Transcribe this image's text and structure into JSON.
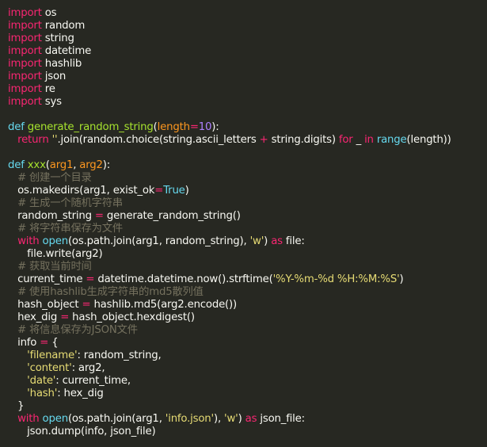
{
  "colors": {
    "background": "#272822",
    "plain": "#f8f8f2",
    "keyword": "#f92672",
    "def": "#66d9ef",
    "func": "#a6e22e",
    "number": "#ae81ff",
    "string": "#e6db74",
    "comment": "#75715e",
    "operator": "#f92672",
    "param": "#fd971f",
    "builtin": "#66d9ef"
  },
  "code": {
    "lines": [
      [
        [
          "keyword",
          "import"
        ],
        [
          "plain",
          " os"
        ]
      ],
      [
        [
          "keyword",
          "import"
        ],
        [
          "plain",
          " random"
        ]
      ],
      [
        [
          "keyword",
          "import"
        ],
        [
          "plain",
          " string"
        ]
      ],
      [
        [
          "keyword",
          "import"
        ],
        [
          "plain",
          " datetime"
        ]
      ],
      [
        [
          "keyword",
          "import"
        ],
        [
          "plain",
          " hashlib"
        ]
      ],
      [
        [
          "keyword",
          "import"
        ],
        [
          "plain",
          " json"
        ]
      ],
      [
        [
          "keyword",
          "import"
        ],
        [
          "plain",
          " re"
        ]
      ],
      [
        [
          "keyword",
          "import"
        ],
        [
          "plain",
          " sys"
        ]
      ],
      [],
      [
        [
          "def",
          "def"
        ],
        [
          "plain",
          " "
        ],
        [
          "func",
          "generate_random_string"
        ],
        [
          "plain",
          "("
        ],
        [
          "param",
          "length"
        ],
        [
          "operator",
          "="
        ],
        [
          "number",
          "10"
        ],
        [
          "plain",
          "):"
        ]
      ],
      [
        [
          "plain",
          "   "
        ],
        [
          "keyword",
          "return"
        ],
        [
          "plain",
          " "
        ],
        [
          "string",
          "''"
        ],
        [
          "plain",
          ".join(random.choice(string.ascii_letters "
        ],
        [
          "operator",
          "+"
        ],
        [
          "plain",
          " string.digits) "
        ],
        [
          "keyword",
          "for"
        ],
        [
          "plain",
          " _ "
        ],
        [
          "keyword",
          "in"
        ],
        [
          "plain",
          " "
        ],
        [
          "builtin",
          "range"
        ],
        [
          "plain",
          "(length))"
        ]
      ],
      [],
      [
        [
          "def",
          "def"
        ],
        [
          "plain",
          " "
        ],
        [
          "func",
          "xxx"
        ],
        [
          "plain",
          "("
        ],
        [
          "param",
          "arg1"
        ],
        [
          "plain",
          ", "
        ],
        [
          "param",
          "arg2"
        ],
        [
          "plain",
          "):"
        ]
      ],
      [
        [
          "plain",
          "   "
        ],
        [
          "comment",
          "# 创建一个目录"
        ]
      ],
      [
        [
          "plain",
          "   os.makedirs(arg1, exist_ok"
        ],
        [
          "operator",
          "="
        ],
        [
          "builtin",
          "True"
        ],
        [
          "plain",
          ")"
        ]
      ],
      [
        [
          "plain",
          "   "
        ],
        [
          "comment",
          "# 生成一个随机字符串"
        ]
      ],
      [
        [
          "plain",
          "   random_string "
        ],
        [
          "operator",
          "="
        ],
        [
          "plain",
          " generate_random_string()"
        ]
      ],
      [
        [
          "plain",
          "   "
        ],
        [
          "comment",
          "# 将字符串保存为文件"
        ]
      ],
      [
        [
          "plain",
          "   "
        ],
        [
          "keyword",
          "with"
        ],
        [
          "plain",
          " "
        ],
        [
          "builtin",
          "open"
        ],
        [
          "plain",
          "(os.path.join(arg1, random_string), "
        ],
        [
          "string",
          "'w'"
        ],
        [
          "plain",
          ") "
        ],
        [
          "keyword",
          "as"
        ],
        [
          "plain",
          " file:"
        ]
      ],
      [
        [
          "plain",
          "      file.write(arg2)"
        ]
      ],
      [
        [
          "plain",
          "   "
        ],
        [
          "comment",
          "# 获取当前时间"
        ]
      ],
      [
        [
          "plain",
          "   current_time "
        ],
        [
          "operator",
          "="
        ],
        [
          "plain",
          " datetime.datetime.now().strftime("
        ],
        [
          "string",
          "'%Y-%m-%d %H:%M:%S'"
        ],
        [
          "plain",
          ")"
        ]
      ],
      [
        [
          "plain",
          "   "
        ],
        [
          "comment",
          "# 使用hashlib生成字符串的md5散列值"
        ]
      ],
      [
        [
          "plain",
          "   hash_object "
        ],
        [
          "operator",
          "="
        ],
        [
          "plain",
          " hashlib.md5(arg2.encode())"
        ]
      ],
      [
        [
          "plain",
          "   hex_dig "
        ],
        [
          "operator",
          "="
        ],
        [
          "plain",
          " hash_object.hexdigest()"
        ]
      ],
      [
        [
          "plain",
          "   "
        ],
        [
          "comment",
          "# 将信息保存为JSON文件"
        ]
      ],
      [
        [
          "plain",
          "   info "
        ],
        [
          "operator",
          "="
        ],
        [
          "plain",
          " {"
        ]
      ],
      [
        [
          "plain",
          "      "
        ],
        [
          "string",
          "'filename'"
        ],
        [
          "plain",
          ": random_string,"
        ]
      ],
      [
        [
          "plain",
          "      "
        ],
        [
          "string",
          "'content'"
        ],
        [
          "plain",
          ": arg2,"
        ]
      ],
      [
        [
          "plain",
          "      "
        ],
        [
          "string",
          "'date'"
        ],
        [
          "plain",
          ": current_time,"
        ]
      ],
      [
        [
          "plain",
          "      "
        ],
        [
          "string",
          "'hash'"
        ],
        [
          "plain",
          ": hex_dig"
        ]
      ],
      [
        [
          "plain",
          "   }"
        ]
      ],
      [
        [
          "plain",
          "   "
        ],
        [
          "keyword",
          "with"
        ],
        [
          "plain",
          " "
        ],
        [
          "builtin",
          "open"
        ],
        [
          "plain",
          "(os.path.join(arg1, "
        ],
        [
          "string",
          "'info.json'"
        ],
        [
          "plain",
          "), "
        ],
        [
          "string",
          "'w'"
        ],
        [
          "plain",
          ") "
        ],
        [
          "keyword",
          "as"
        ],
        [
          "plain",
          " json_file:"
        ]
      ],
      [
        [
          "plain",
          "      json.dump(info, json_file)"
        ]
      ]
    ]
  }
}
